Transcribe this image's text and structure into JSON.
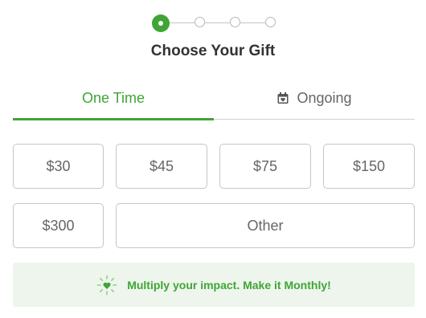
{
  "stepper": {
    "total_steps": 4,
    "current_step": 1
  },
  "title": "Choose Your Gift",
  "tabs": [
    {
      "label": "One Time",
      "active": true
    },
    {
      "label": "Ongoing",
      "active": false,
      "icon": "calendar-heart-icon"
    }
  ],
  "amounts": [
    "$30",
    "$45",
    "$75",
    "$150",
    "$300"
  ],
  "other_label": "Other",
  "banner": {
    "text": "Multiply your impact. Make it Monthly!",
    "icon": "sparkle-heart-icon"
  },
  "colors": {
    "accent": "#3fa535",
    "banner_bg": "#edf5ec",
    "text": "#666666",
    "title": "#333333",
    "border": "#c6c6c6"
  }
}
